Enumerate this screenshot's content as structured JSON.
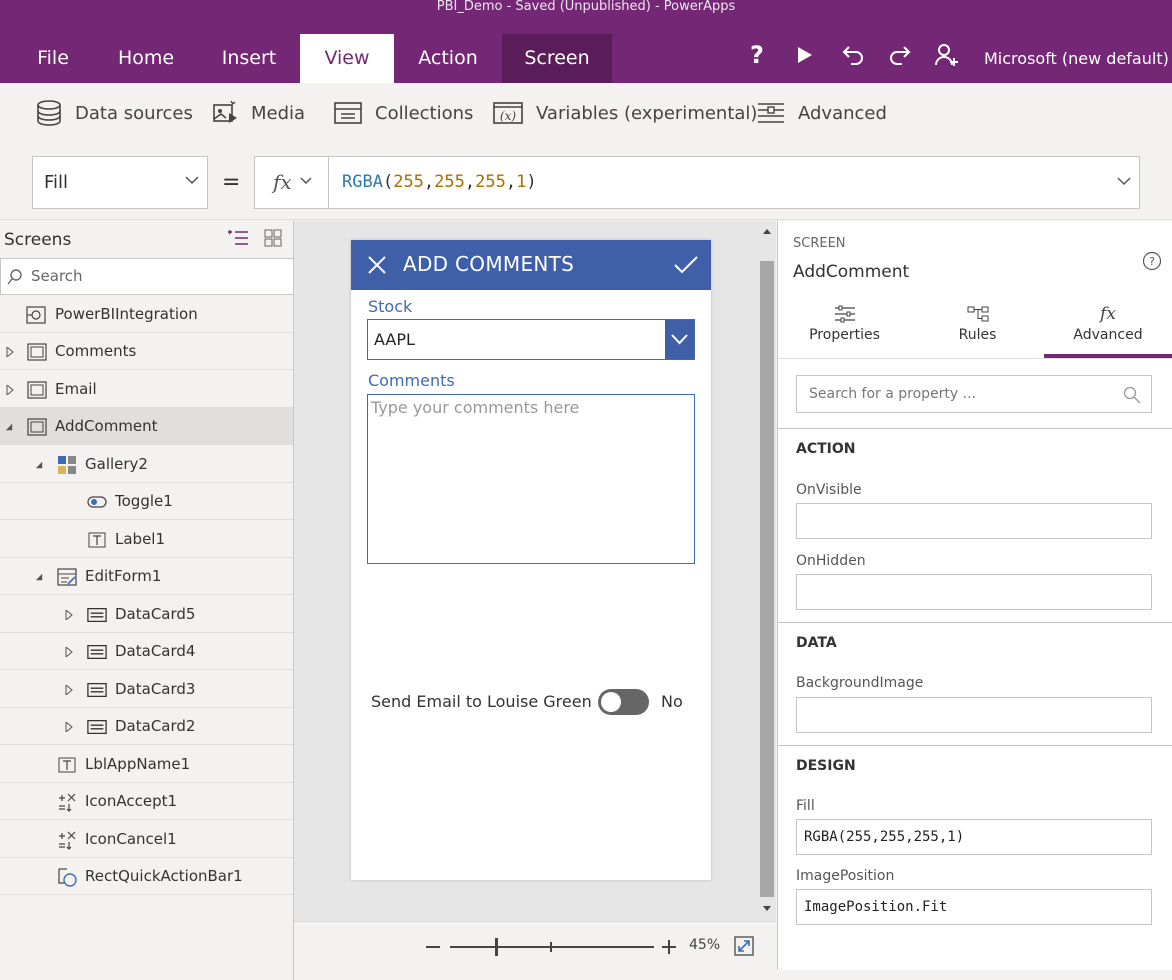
{
  "window_title": "PBI_Demo - Saved (Unpublished) - PowerApps",
  "menu": {
    "file": "File",
    "home": "Home",
    "insert": "Insert",
    "view": "View",
    "action": "Action",
    "screen": "Screen",
    "environment": "Microsoft (new default)"
  },
  "ribbon": {
    "data_sources": "Data sources",
    "media": "Media",
    "collections": "Collections",
    "variables": "Variables (experimental)",
    "advanced": "Advanced"
  },
  "formula_bar": {
    "property": "Fill",
    "equals": "=",
    "fx": "fx",
    "func": "RGBA",
    "args": [
      "255",
      "255",
      "255",
      "1"
    ]
  },
  "tree": {
    "title": "Screens",
    "search_placeholder": "Search",
    "items": [
      {
        "label": "PowerBIIntegration",
        "icon": "screen-play-icon"
      },
      {
        "label": "Comments",
        "icon": "screen-icon"
      },
      {
        "label": "Email",
        "icon": "screen-icon"
      },
      {
        "label": "AddComment",
        "icon": "screen-icon"
      },
      {
        "label": "Gallery2",
        "icon": "gallery-icon"
      },
      {
        "label": "Toggle1",
        "icon": "toggle-icon"
      },
      {
        "label": "Label1",
        "icon": "label-icon"
      },
      {
        "label": "EditForm1",
        "icon": "form-icon"
      },
      {
        "label": "DataCard5",
        "icon": "datacard-icon"
      },
      {
        "label": "DataCard4",
        "icon": "datacard-icon"
      },
      {
        "label": "DataCard3",
        "icon": "datacard-icon"
      },
      {
        "label": "DataCard2",
        "icon": "datacard-icon"
      },
      {
        "label": "LblAppName1",
        "icon": "label-icon"
      },
      {
        "label": "IconAccept1",
        "icon": "icon-control-icon"
      },
      {
        "label": "IconCancel1",
        "icon": "icon-control-icon"
      },
      {
        "label": "RectQuickActionBar1",
        "icon": "shape-icon"
      }
    ]
  },
  "canvas": {
    "header_title": "ADD COMMENTS",
    "stock_label": "Stock",
    "stock_value": "AAPL",
    "comments_label": "Comments",
    "comments_placeholder": "Type your comments here",
    "send_email_label": "Send Email to Louise Green",
    "toggle_text": "No",
    "zoom": "45%"
  },
  "panel": {
    "kind": "SCREEN",
    "name": "AddComment",
    "tabs": {
      "properties": "Properties",
      "rules": "Rules",
      "advanced": "Advanced"
    },
    "search_placeholder": "Search for a property ...",
    "sections": {
      "action": "ACTION",
      "data": "DATA",
      "design": "DESIGN"
    },
    "props": {
      "onvisible_label": "OnVisible",
      "onvisible_value": "",
      "onhidden_label": "OnHidden",
      "onhidden_value": "",
      "bgimage_label": "BackgroundImage",
      "bgimage_value": "",
      "fill_label": "Fill",
      "fill_value": "RGBA(255,255,255,1)",
      "imagepos_label": "ImagePosition",
      "imagepos_value": "ImagePosition.Fit"
    }
  },
  "colors": {
    "brand": "#742774",
    "form_header": "#3f5fa8",
    "accent_tab": "#742774"
  }
}
